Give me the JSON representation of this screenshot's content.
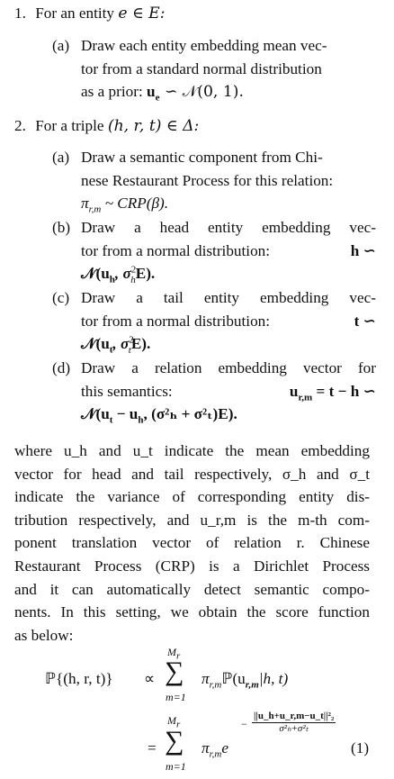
{
  "step1": {
    "num": "1.",
    "text": "For an entity",
    "math": "e ∈ E:",
    "a": {
      "label": "(a)",
      "line1": "Draw each entity embedding mean vec-",
      "line2": "tor from a standard normal distribution",
      "line3": "as a prior:",
      "math": "u",
      "math_sub": "e",
      "math_rest": " ∽ 𝒩(0, 1)."
    }
  },
  "step2": {
    "num": "2.",
    "text": "For a triple",
    "math": "(h, r, t) ∈ Δ:",
    "a": {
      "label": "(a)",
      "line1": "Draw a semantic component from Chi-",
      "line2": "nese Restaurant Process for this relation:",
      "math": "π",
      "math_sub": "r,m",
      "math_rest": " ~ CRP(β)."
    },
    "b": {
      "label": "(b)",
      "line1": "Draw a head entity embedding vec-",
      "line2": "tor from a normal distribution:",
      "line2_math": "h ∽",
      "line3": "𝒩(u",
      "line3_sub": "h",
      "line3_mid": ", σ",
      "line3_sup": "2",
      "line3_sub2": "h",
      "line3_end": "E)."
    },
    "c": {
      "label": "(c)",
      "line1": "Draw a tail entity embedding vec-",
      "line2": "tor from a normal distribution:",
      "line2_math": "t ∽",
      "line3": "𝒩(u",
      "line3_sub": "t",
      "line3_mid": ", σ",
      "line3_sup": "2",
      "line3_sub2": "t",
      "line3_end": "E)."
    },
    "d": {
      "label": "(d)",
      "line1": "Draw a relation embedding vector for",
      "line2": "this semantics:",
      "line2_math": "u",
      "line2_sub": "r,m",
      "line2_rest": " = t − h ∽",
      "line3": "𝒩(u",
      "line3_sub": "t",
      "line3_mid": " − u",
      "line3_sub2": "h",
      "line3_end": ", (σ²ₕ + σ²ₜ)E)."
    }
  },
  "paragraph": [
    "where u_h and u_t indicate the mean embedding",
    "vector for head and tail respectively, σ_h and σ_t",
    "indicate the variance of corresponding entity dis-",
    "tribution respectively, and u_r,m is the m-th com-",
    "ponent translation vector of relation r.  Chinese",
    "Restaurant Process (CRP) is a Dirichlet Process",
    "and it can automatically detect semantic compo-",
    "nents. In this setting, we obtain the score function",
    "as below:"
  ],
  "equation": {
    "lhs": "ℙ{(h, r, t)}",
    "propto": "∝",
    "sum_upper": "M",
    "sum_upper_sub": "r",
    "sum_lower": "m=1",
    "term1": "π",
    "term1_sub": "r,m",
    "term1_rest": "ℙ(u",
    "term1_sub2": "r,m",
    "term1_end": "|h, t)",
    "eq": "=",
    "term2": "π",
    "term2_sub": "r,m",
    "term2_e": "e",
    "exp_num": "||u_h+u_r,m−u_t||²₂",
    "exp_den": "σ²ₕ+σ²ₜ",
    "exp_minus": "−",
    "number": "(1)"
  }
}
